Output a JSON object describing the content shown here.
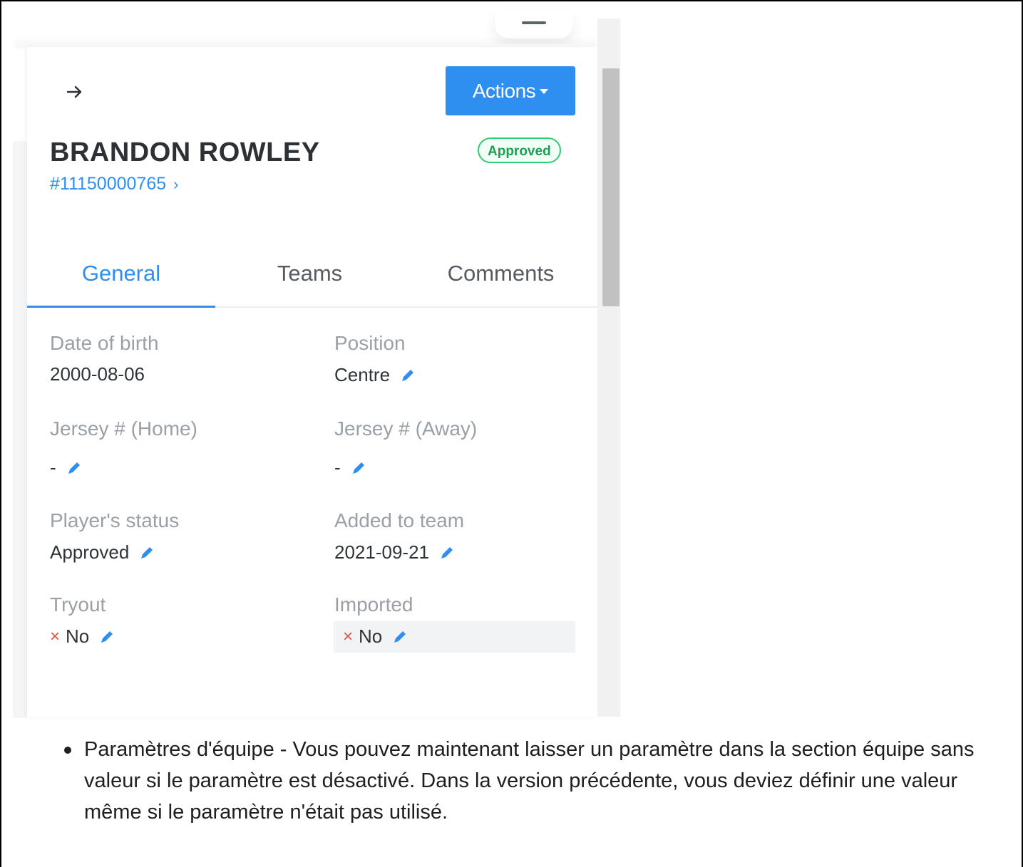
{
  "panel": {
    "actions_label": "Actions",
    "player_name": "BRANDON ROWLEY",
    "status_badge": "Approved",
    "player_id": "#11150000765",
    "id_chevron": "›"
  },
  "tabs": [
    {
      "label": "General",
      "active": true
    },
    {
      "label": "Teams",
      "active": false
    },
    {
      "label": "Comments",
      "active": false
    }
  ],
  "fields": {
    "dob_label": "Date of birth",
    "dob_value": "2000-08-06",
    "position_label": "Position",
    "position_value": "Centre",
    "jersey_home_label": "Jersey # (Home)",
    "jersey_home_value": "-",
    "jersey_away_label": "Jersey # (Away)",
    "jersey_away_value": "-",
    "player_status_label": "Player's status",
    "player_status_value": "Approved",
    "added_label": "Added to team",
    "added_value": "2021-09-21",
    "tryout_label": "Tryout",
    "tryout_value": "No",
    "imported_label": "Imported",
    "imported_value": "No",
    "x_glyph": "×"
  },
  "note": {
    "text": "Paramètres d'équipe - Vous pouvez maintenant laisser un paramètre dans la section équipe sans valeur si le paramètre est désactivé.  Dans la version précédente, vous deviez définir une valeur même si le paramètre n'était pas utilisé."
  },
  "colors": {
    "accent": "#2f8ff0",
    "approved_green": "#2ecc71",
    "no_red": "#e74c3c"
  },
  "icons": {
    "back": "arrow-right-icon",
    "caret": "caret-down-icon",
    "edit": "pencil-icon",
    "no": "close-x-icon"
  }
}
